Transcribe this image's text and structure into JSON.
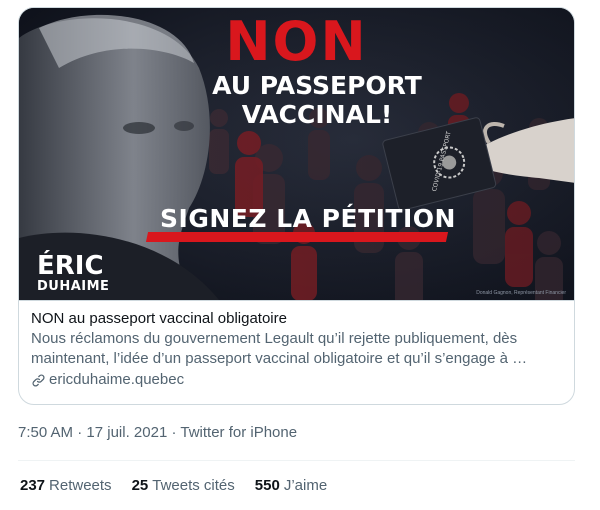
{
  "card": {
    "image": {
      "headline_main": "NON",
      "headline_line1": "AU PASSEPORT",
      "headline_line2": "VACCINAL!",
      "callout": "SIGNEZ LA PÉTITION",
      "logo_first": "ÉRIC",
      "logo_last": "DUHAIME",
      "passport_text": "COVID-19 PASSPORT",
      "photo_credit": "Donald Gagnon, Représentant Financier"
    },
    "title": "NON au passeport vaccinal obligatoire",
    "description_line1": "Nous réclamons du gouvernement Legault qu’il rejette publiquement, dès",
    "description_line2": "maintenant, l’idée d’un passeport vaccinal obligatoire et qu’il s’engage à …",
    "domain": "ericduhaime.quebec",
    "link_icon": "link-icon"
  },
  "meta": {
    "time": "7:50 AM",
    "separator": " · ",
    "date": "17 juil. 2021",
    "source": "Twitter for iPhone"
  },
  "stats": {
    "retweets_count": "237",
    "retweets_label": "Retweets",
    "quotes_count": "25",
    "quotes_label": "Tweets cités",
    "likes_count": "550",
    "likes_label": "J’aime"
  },
  "colors": {
    "accent_red": "#d9171d",
    "secondary_text": "#536471",
    "primary_text": "#0f1419",
    "border": "#cfd9de"
  }
}
